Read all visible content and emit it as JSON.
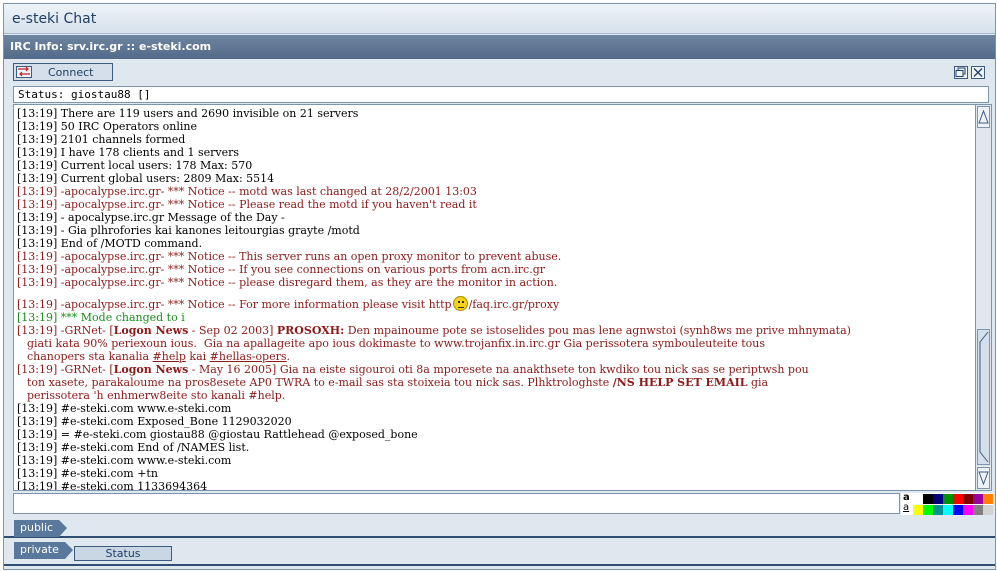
{
  "window": {
    "title": "e-steki Chat",
    "info": "IRC Info: srv.irc.gr :: e-steki.com"
  },
  "toolbar": {
    "connect_label": "Connect",
    "restore_icon": "restore-icon",
    "close_icon": "close-icon"
  },
  "status_line": "Status: giostau88 []",
  "log": {
    "lines": [
      "[13:19] There are 119 users and 2690 invisible on 21 servers",
      "[13:19] 50 IRC Operators online",
      "[13:19] 2101 channels formed",
      "[13:19] I have 178 clients and 1 servers",
      "[13:19] Current local users: 178 Max: 570",
      "[13:19] Current global users: 2809 Max: 5514",
      "[13:19] -apocalypse.irc.gr- *** Notice -- motd was last changed at 28/2/2001 13:03",
      "[13:19] -apocalypse.irc.gr- *** Notice -- Please read the motd if you haven't read it",
      "[13:19] - apocalypse.irc.gr Message of the Day -",
      "[13:19] - Gia plhrofories kai kanones leitourgias grayte /motd",
      "[13:19] End of /MOTD command.",
      "[13:19] -apocalypse.irc.gr- *** Notice -- This server runs an open proxy monitor to prevent abuse.",
      "[13:19] -apocalypse.irc.gr- *** Notice -- If you see connections on various ports from acn.irc.gr",
      "[13:19] -apocalypse.irc.gr- *** Notice -- please disregard them, as they are the monitor in action."
    ],
    "proxy_line_a": "[13:19] -apocalypse.irc.gr- *** Notice -- For more information please visit http",
    "proxy_line_b": "/faq.irc.gr/proxy",
    "mode_line": "[13:19] *** Mode changed to i",
    "news1": {
      "prefix": "[13:19] -GRNet- [",
      "tag": "Logon News",
      "date": " - Sep 02 2003] ",
      "head": "PROSOXH:",
      "body1": " Den mpainoume pote se istoselides pou mas lene agnwstoi (synh8ws me prive mhnymata)",
      "body2": "giati kata 90% periexoun ious.  Gia na apallageite apo ious dokimaste to www.trojanfix.in.irc.gr Gia perissotera symbouleuteite tous",
      "body3a": "chanopers sta kanalia ",
      "link1": "#help",
      "body3b": " kai ",
      "link2": "#hellas-opers",
      "body3c": "."
    },
    "news2": {
      "prefix": "[13:19] -GRNet- [",
      "tag": "Logon News",
      "date": " - May 16 2005] ",
      "body1": "Gia na eiste sigouroi oti 8a mporesete na anakthsete ton kwdiko tou nick sas se periptwsh pou",
      "body2a": "ton xasete, parakaloume na pros8esete AP0 TWRA to e-mail sas sta stoixeia tou nick sas. Plhktrologhste ",
      "cmd": "/NS HELP SET EMAIL",
      "body2b": " gia",
      "body3": "perissotera 'h enhmerw8eite sto kanali #help."
    },
    "tail_lines": [
      "[13:19] #e-steki.com www.e-steki.com",
      "[13:19] #e-steki.com Exposed_Bone 1129032020",
      "[13:19] = #e-steki.com giostau88 @giostau Rattlehead @exposed_bone",
      "[13:19] #e-steki.com End of /NAMES list.",
      "[13:19] #e-steki.com www.e-steki.com",
      "[13:19] #e-steki.com +tn",
      "[13:19] #e-steki.com 1133694364"
    ]
  },
  "input": {
    "value": ""
  },
  "palette": {
    "label_top": "a",
    "label_bottom": "a",
    "row1": [
      "#ffffff",
      "#000000",
      "#00007f",
      "#009300",
      "#ff0000",
      "#7f0000",
      "#9c009c",
      "#fc7f00"
    ],
    "row2": [
      "#ffff00",
      "#00fc00",
      "#009393",
      "#00ffff",
      "#0000fc",
      "#ff00ff",
      "#7f7f7f",
      "#d2d2d2"
    ]
  },
  "tabs": {
    "public": "public",
    "private": "private",
    "status": "Status"
  }
}
